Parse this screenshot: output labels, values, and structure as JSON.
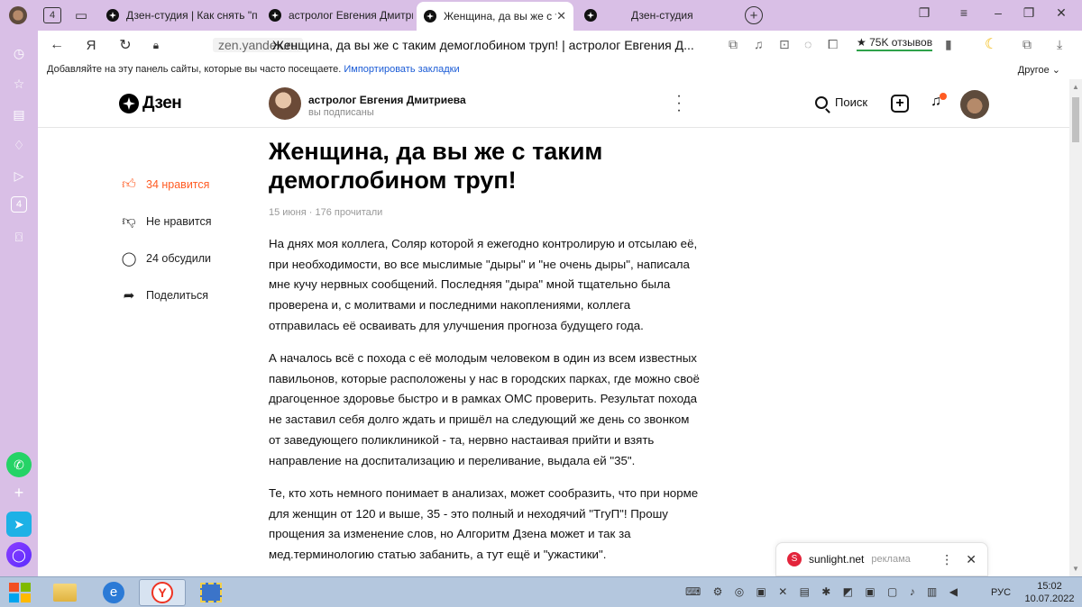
{
  "browser": {
    "tab_count_badge": "4",
    "tabs": [
      {
        "title": "Дзен-студия | Как снять \"п",
        "active": false
      },
      {
        "title": "астролог Евгения Дмитри",
        "active": false
      },
      {
        "title": "Женщина, да вы же с та",
        "active": true
      },
      {
        "title": "Дзен-студия",
        "active": false
      }
    ],
    "url_domain": "zen.yandex.ru",
    "page_title": "Женщина, да вы же с таким демоглобином труп! | астролог Евгения Д...",
    "reviews_label": "★ 75K отзывов",
    "bookmarks_prompt": "Добавляйте на эту панель сайты, которые вы часто посещаете.",
    "bookmarks_import": "Импортировать закладки",
    "bookmarks_other": "Другое",
    "sidebar_counter": "4"
  },
  "header": {
    "logo": "Дзен",
    "author_name": "астролог Евгения Дмитриева",
    "author_status": "вы подписаны",
    "search_label": "Поиск"
  },
  "actions": {
    "likes": "34 нравится",
    "dislike": "Не нравится",
    "comments": "24 обсудили",
    "share": "Поделиться"
  },
  "article": {
    "title": "Женщина, да вы же с таким демоглобином труп!",
    "meta": "15 июня · 176 прочитали",
    "paragraphs": [
      "На днях моя коллега, Соляр которой я ежегодно контролирую и отсылаю её, при необходимости, во все мыслимые \"дыры\" и \"не очень дыры\", написала мне кучу нервных сообщений. Последняя \"дыра\" мной тщательно была проверена и, с молитвами и последними накоплениями, коллега отправилась её осваивать для улучшения прогноза будущего года.",
      "А началось всё с похода с её молодым человеком в один из всем известных павильонов, которые расположены у нас в городских парках, где можно своё драгоценное здоровье быстро и в рамках ОМС проверить. Результат похода не заставил себя долго ждать и пришёл на следующий же день со звонком от заведующего поликлиникой - та, нервно настаивая прийти и взять направление на доспитализацию и переливание, выдала ей \"35\".",
      "Те, кто хоть немного понимает в анализах, может сообразить, что при норме для женщин от 120 и выше, 35 - это полный и неходячий \"ТгуП\"! Прошу прощения за изменение слов, но Алгоритм Дзена может и так за мед.терминологию статью забанить, а тут ещё и \"ужастики\"."
    ]
  },
  "ad": {
    "domain": "sunlight.net",
    "label": "реклама"
  },
  "taskbar": {
    "lang": "РУС",
    "time": "15:02",
    "date": "10.07.2022"
  },
  "colors": {
    "titlebar": "#d9bfe6",
    "like_accent": "#ff5b22",
    "taskbar": "#b4c7de"
  }
}
